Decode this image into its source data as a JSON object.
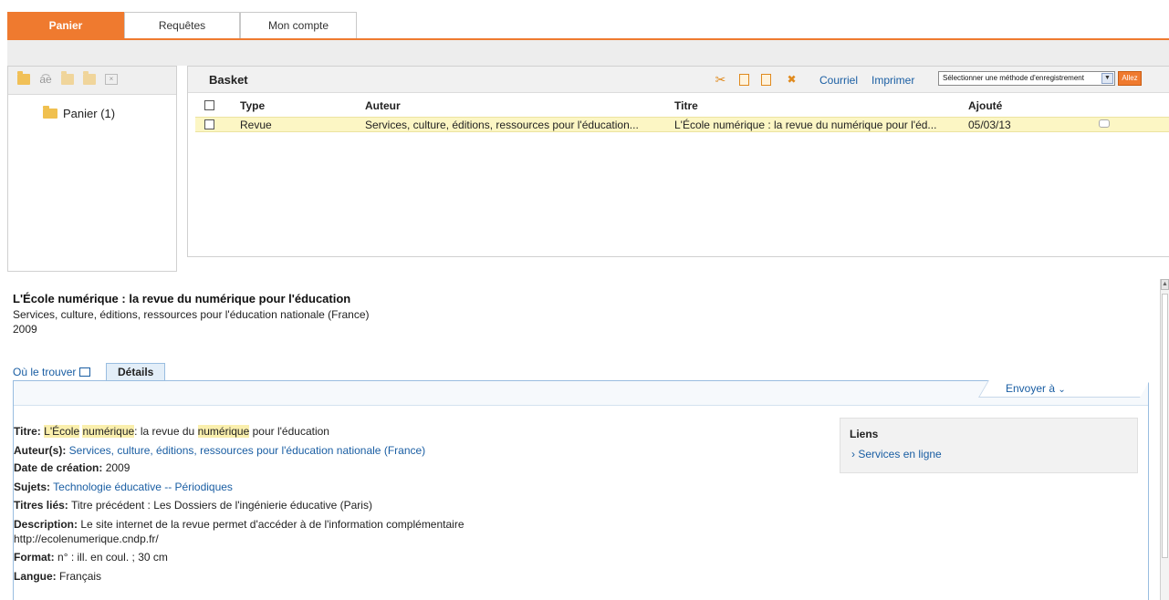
{
  "tabs": [
    {
      "label": "Panier"
    },
    {
      "label": "Requêtes"
    },
    {
      "label": "Mon compte"
    }
  ],
  "left_panel": {
    "toolbar_icons": [
      "new-folder-icon",
      "rename-icon",
      "copy-folder-icon",
      "paste-folder-icon",
      "delete-folder-icon"
    ],
    "tree_item": "Panier (1)"
  },
  "basket": {
    "title": "Basket",
    "actions": {
      "courriel": "Courriel",
      "imprimer": "Imprimer"
    },
    "save_select": "Sélectionner une méthode d'enregistrement",
    "go_button": "Allez",
    "columns": [
      "Type",
      "Auteur",
      "Titre",
      "Ajouté"
    ],
    "rows": [
      {
        "type": "Revue",
        "auteur": "Services, culture, éditions, ressources pour l'éducation...",
        "titre": "L'École numérique : la revue du numérique pour l'éd...",
        "ajoute": "05/03/13"
      }
    ]
  },
  "record": {
    "title": "L'École numérique : la revue du numérique pour l'éducation",
    "author": "Services, culture, éditions, ressources pour l'éducation nationale (France)",
    "year": "2009",
    "tab_where": "Où le trouver",
    "tab_details": "Détails",
    "send_to": "Envoyer à",
    "fields": {
      "titre_label": "Titre:",
      "titre_hl1": "L'École",
      "titre_hl2": "numérique",
      "titre_mid": ": la revue du",
      "titre_hl3": "numérique",
      "titre_end": "pour l'éducation",
      "auteurs_label": "Auteur(s):",
      "auteurs_value": "Services, culture, éditions, ressources pour l'éducation nationale (France)",
      "date_label": "Date de création:",
      "date_value": "2009",
      "sujets_label": "Sujets:",
      "sujets_value": "Technologie éducative -- Périodiques",
      "titres_lies_label": "Titres liés:",
      "titres_lies_value": "Titre précédent : Les Dossiers de l'ingénierie éducative (Paris)",
      "description_label": "Description:",
      "description_value": "Le site internet de la revue permet d'accéder à de l'information complémentaire",
      "description_url": "http://ecolenumerique.cndp.fr/",
      "format_label": "Format:",
      "format_value": "n° : ill. en coul. ; 30 cm",
      "langue_label": "Langue:",
      "langue_value": "Français"
    },
    "liens": {
      "title": "Liens",
      "link": "Services en ligne"
    }
  },
  "colors": {
    "accent": "#ef7a2f",
    "link": "#1a5ea3",
    "row_highlight": "#fcf6c4",
    "term_highlight": "#faefad"
  }
}
